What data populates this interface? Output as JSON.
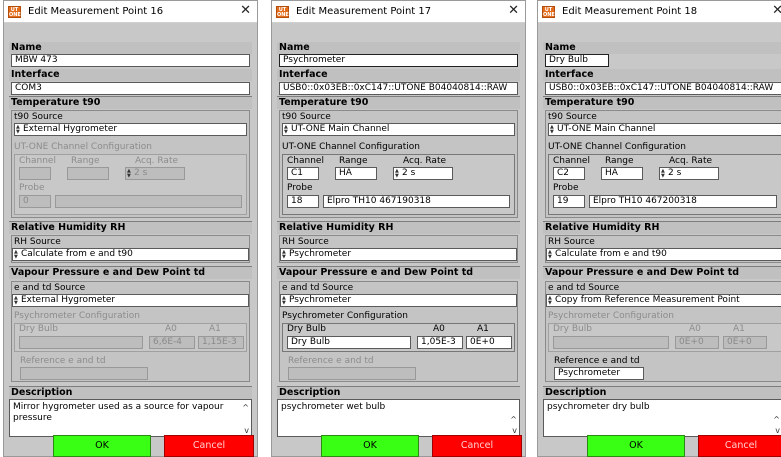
{
  "dialogs": [
    {
      "title": "Edit Measurement Point 16",
      "name_label": "Name",
      "name_value": "MBW 473",
      "interface_label": "Interface",
      "interface_value": "COM3",
      "temp_head": "Temperature t90",
      "t90_source_label": "t90 Source",
      "t90_source_value": "External Hygrometer",
      "utone_label": "UT-ONE Channel Configuration",
      "channel_label": "Channel",
      "range_label": "Range",
      "acq_label": "Acq. Rate",
      "channel_value": "",
      "range_value": "",
      "acq_value": "2 s",
      "probe_label": "Probe",
      "probe_num": "0",
      "probe_name": "",
      "rh_head": "Relative Humidity RH",
      "rh_source_label": "RH Source",
      "rh_source_value": "Calculate from e and t90",
      "vp_head": "Vapour Pressure e and Dew Point td",
      "etd_source_label": "e and td Source",
      "etd_source_value": "External Hygrometer",
      "psy_label": "Psychrometer Configuration",
      "dry_bulb_label": "Dry Bulb",
      "dry_bulb_value": "",
      "a0_label": "A0",
      "a1_label": "A1",
      "a0_value": "6,6E-4",
      "a1_value": "1,15E-3",
      "ref_label": "Reference e and td",
      "ref_value": "",
      "desc_head": "Description",
      "desc_value": "Mirror hygrometer used as a source for vapour pressure",
      "ok_label": "OK",
      "cancel_label": "Cancel"
    },
    {
      "title": "Edit Measurement Point 17",
      "name_label": "Name",
      "name_value": "Psychrometer",
      "interface_label": "Interface",
      "interface_value": "USB0::0x03EB::0xC147::UTONE B04040814::RAW",
      "temp_head": "Temperature t90",
      "t90_source_label": "t90 Source",
      "t90_source_value": "UT-ONE Main Channel",
      "utone_label": "UT-ONE Channel Configuration",
      "channel_label": "Channel",
      "range_label": "Range",
      "acq_label": "Acq. Rate",
      "channel_value": "C1",
      "range_value": "HA",
      "acq_value": "2 s",
      "probe_label": "Probe",
      "probe_num": "18",
      "probe_name": "Elpro TH10 467190318",
      "rh_head": "Relative Humidity RH",
      "rh_source_label": "RH Source",
      "rh_source_value": "Psychrometer",
      "vp_head": "Vapour Pressure e and Dew Point td",
      "etd_source_label": "e and td Source",
      "etd_source_value": "Psychrometer",
      "psy_label": "Psychrometer Configuration",
      "dry_bulb_label": "Dry Bulb",
      "dry_bulb_value": "Dry Bulb",
      "a0_label": "A0",
      "a1_label": "A1",
      "a0_value": "1,05E-3",
      "a1_value": "0E+0",
      "ref_label": "Reference e and td",
      "ref_value": "",
      "desc_head": "Description",
      "desc_value": "psychrometer wet bulb",
      "ok_label": "OK",
      "cancel_label": "Cancel"
    },
    {
      "title": "Edit Measurement Point 18",
      "name_label": "Name",
      "name_value": "Dry Bulb",
      "interface_label": "Interface",
      "interface_value": "USB0::0x03EB::0xC147::UTONE B04040814::RAW",
      "temp_head": "Temperature t90",
      "t90_source_label": "t90 Source",
      "t90_source_value": "UT-ONE Main Channel",
      "utone_label": "UT-ONE Channel Configuration",
      "channel_label": "Channel",
      "range_label": "Range",
      "acq_label": "Acq. Rate",
      "channel_value": "C2",
      "range_value": "HA",
      "acq_value": "2 s",
      "probe_label": "Probe",
      "probe_num": "19",
      "probe_name": "Elpro TH10 467200318",
      "rh_head": "Relative Humidity RH",
      "rh_source_label": "RH Source",
      "rh_source_value": "Calculate from e and t90",
      "vp_head": "Vapour Pressure e and Dew Point td",
      "etd_source_label": "e and td Source",
      "etd_source_value": "Copy from Reference Measurement Point",
      "psy_label": "Psychrometer Configuration",
      "dry_bulb_label": "Dry Bulb",
      "dry_bulb_value": "",
      "a0_label": "A0",
      "a1_label": "A1",
      "a0_value": "0E+0",
      "a1_value": "0E+0",
      "ref_label": "Reference e and td",
      "ref_value": "Psychrometer",
      "desc_head": "Description",
      "desc_value": "psychrometer dry bulb",
      "ok_label": "OK",
      "cancel_label": "Cancel"
    }
  ],
  "app_icon_text": "UT ONE",
  "colors": {
    "ok": "#39ff14",
    "cancel": "#ff0000",
    "panel": "#c8c8c8"
  },
  "icons": {
    "close": "close-icon",
    "spin": "spinner-icon",
    "scroll": "scroll-arrow-icon",
    "app": "app-icon"
  }
}
